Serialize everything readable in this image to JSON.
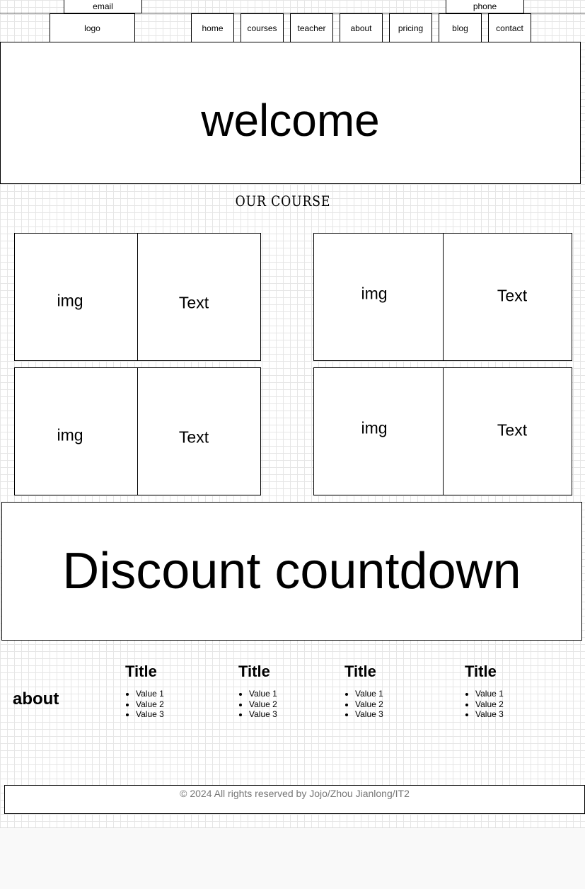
{
  "topbar": {
    "email_label": "email",
    "phone_label": "phone"
  },
  "nav": {
    "logo_label": "logo",
    "items": [
      "home",
      "courses",
      "teacher",
      "about",
      "pricing",
      "blog",
      "contact"
    ]
  },
  "hero": {
    "title": "welcome"
  },
  "courses": {
    "heading": "OUR COURSE",
    "cards": [
      {
        "img_label": "img",
        "text_label": "Text"
      },
      {
        "img_label": "img",
        "text_label": "Text"
      },
      {
        "img_label": "img",
        "text_label": "Text"
      },
      {
        "img_label": "img",
        "text_label": "Text"
      }
    ]
  },
  "discount": {
    "title": "Discount countdown"
  },
  "footer_links": {
    "about_label": "about",
    "columns": [
      {
        "title": "Title",
        "values": [
          "Value 1",
          "Value 2",
          "Value 3"
        ]
      },
      {
        "title": "Title",
        "values": [
          "Value 1",
          "Value 2",
          "Value 3"
        ]
      },
      {
        "title": "Title",
        "values": [
          "Value 1",
          "Value 2",
          "Value 3"
        ]
      },
      {
        "title": "Title",
        "values": [
          "Value 1",
          "Value 2",
          "Value 3"
        ]
      }
    ]
  },
  "footer": {
    "copyright": "© 2024 All rights reserved by Jojo/Zhou Jianlong/IT2"
  }
}
